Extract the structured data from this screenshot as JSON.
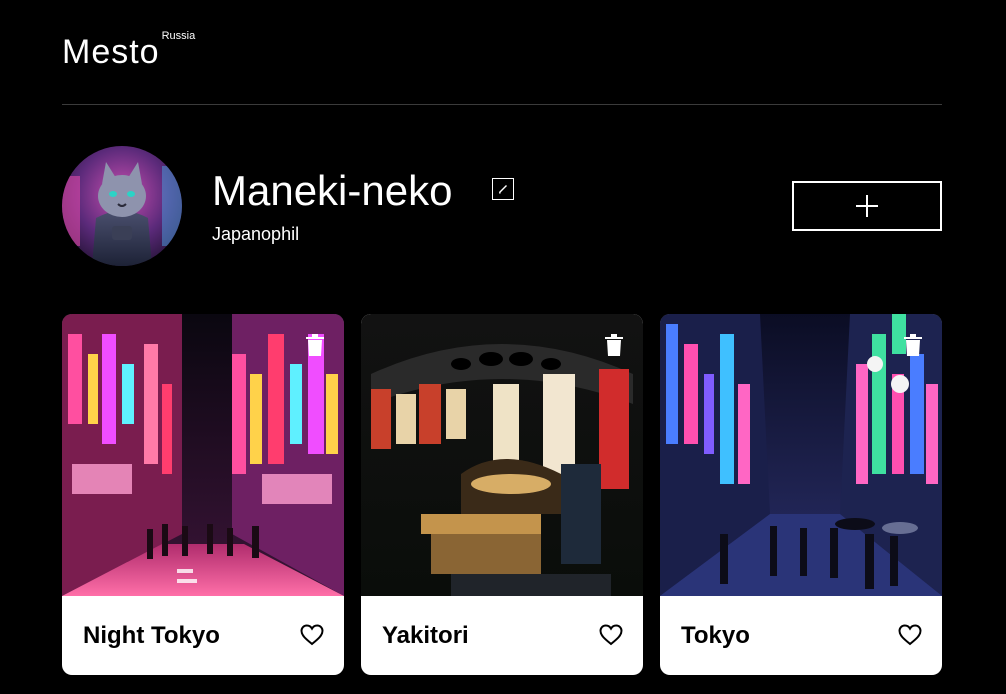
{
  "header": {
    "logo_main": "Mesto",
    "logo_sub": "Russia"
  },
  "profile": {
    "name": "Maneki-neko",
    "about": "Japanophil"
  },
  "icons": {
    "edit": "pencil-icon",
    "add": "plus-icon",
    "delete": "trash-icon",
    "like": "heart-icon"
  },
  "colors": {
    "background": "#000000",
    "card": "#ffffff",
    "text_dark": "#000000",
    "text_light": "#ffffff"
  },
  "cards": [
    {
      "title": "Night Tokyo"
    },
    {
      "title": "Yakitori"
    },
    {
      "title": "Tokyo"
    }
  ]
}
